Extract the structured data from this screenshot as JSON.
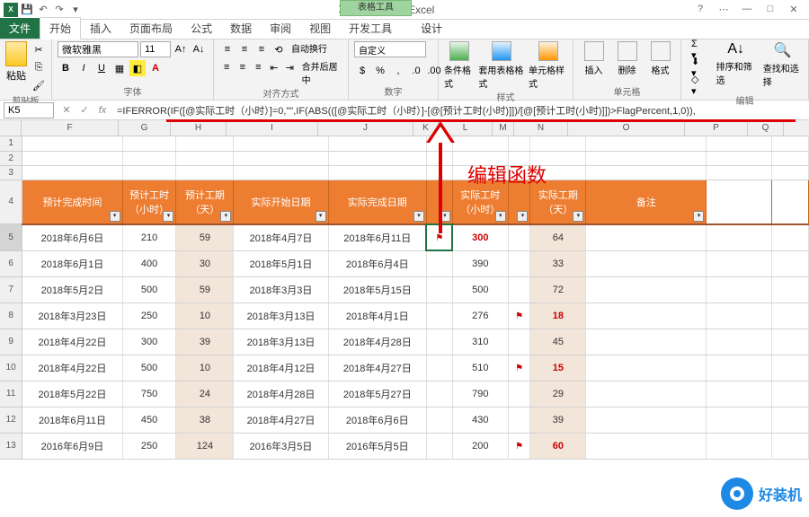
{
  "title": "项目跟踪器1 - Excel",
  "context_tab": "表格工具",
  "tabs": {
    "file": "文件",
    "home": "开始",
    "insert": "插入",
    "layout": "页面布局",
    "formulas": "公式",
    "data": "数据",
    "review": "审阅",
    "view": "视图",
    "developer": "开发工具",
    "design": "设计"
  },
  "ribbon": {
    "clipboard": "剪贴板",
    "paste": "粘贴",
    "font_group": "字体",
    "font_name": "微软雅黑",
    "font_size": "11",
    "align_group": "对齐方式",
    "wrap": "自动换行",
    "merge": "合并后居中",
    "number_group": "数字",
    "number_format": "自定义",
    "styles_group": "样式",
    "cond_format": "条件格式",
    "table_format": "套用表格格式",
    "cell_styles": "单元格样式",
    "cells_group": "单元格",
    "insert_cell": "插入",
    "delete_cell": "删除",
    "format_cell": "格式",
    "edit_group": "编辑",
    "sort_filter": "排序和筛选",
    "find_select": "查找和选择"
  },
  "name_box": "K5",
  "formula": "=IFERROR(IF([@实际工时（小时）]=0,\"\",IF(ABS(([@实际工时（小时）]-[@[预计工时(小时)]])/[@[预计工时(小时)]])>FlagPercent,1,0)),",
  "columns": [
    "F",
    "G",
    "H",
    "I",
    "J",
    "K",
    "L",
    "M",
    "N",
    "O",
    "P",
    "Q"
  ],
  "headers": {
    "f": "预计完成时间",
    "g": "预计工时（小时）",
    "h": "预计工期（天）",
    "i": "实际开始日期",
    "j": "实际完成日期",
    "k": "",
    "l": "实际工时（小时）",
    "n": "实际工期（天）",
    "o": "备注"
  },
  "rows": [
    {
      "n": "5",
      "f": "2018年6月6日",
      "g": "210",
      "h": "59",
      "i": "2018年4月7日",
      "j": "2018年6月11日",
      "kflag": true,
      "l": "300",
      "lred": true,
      "mflag": false,
      "nval": "64",
      "nred": false
    },
    {
      "n": "6",
      "f": "2018年6月1日",
      "g": "400",
      "h": "30",
      "i": "2018年5月1日",
      "j": "2018年6月4日",
      "kflag": false,
      "l": "390",
      "lred": false,
      "mflag": false,
      "nval": "33",
      "nred": false
    },
    {
      "n": "7",
      "f": "2018年5月2日",
      "g": "500",
      "h": "59",
      "i": "2018年3月3日",
      "j": "2018年5月15日",
      "kflag": false,
      "l": "500",
      "lred": false,
      "mflag": false,
      "nval": "72",
      "nred": false
    },
    {
      "n": "8",
      "f": "2018年3月23日",
      "g": "250",
      "h": "10",
      "i": "2018年3月13日",
      "j": "2018年4月1日",
      "kflag": false,
      "l": "276",
      "lred": false,
      "mflag": true,
      "nval": "18",
      "nred": true
    },
    {
      "n": "9",
      "f": "2018年4月22日",
      "g": "300",
      "h": "39",
      "i": "2018年3月13日",
      "j": "2018年4月28日",
      "kflag": false,
      "l": "310",
      "lred": false,
      "mflag": false,
      "nval": "45",
      "nred": false
    },
    {
      "n": "10",
      "f": "2018年4月22日",
      "g": "500",
      "h": "10",
      "i": "2018年4月12日",
      "j": "2018年4月27日",
      "kflag": false,
      "l": "510",
      "lred": false,
      "mflag": true,
      "nval": "15",
      "nred": true
    },
    {
      "n": "11",
      "f": "2018年5月22日",
      "g": "750",
      "h": "24",
      "i": "2018年4月28日",
      "j": "2018年5月27日",
      "kflag": false,
      "l": "790",
      "lred": false,
      "mflag": false,
      "nval": "29",
      "nred": false
    },
    {
      "n": "12",
      "f": "2018年6月11日",
      "g": "450",
      "h": "38",
      "i": "2018年4月27日",
      "j": "2018年6月6日",
      "kflag": false,
      "l": "430",
      "lred": false,
      "mflag": false,
      "nval": "39",
      "nred": false
    },
    {
      "n": "13",
      "f": "2016年6月9日",
      "g": "250",
      "h": "124",
      "i": "2016年3月5日",
      "j": "2016年5月5日",
      "kflag": false,
      "l": "200",
      "lred": false,
      "mflag": true,
      "nval": "60",
      "nred": true
    }
  ],
  "annotation": "编辑函数",
  "watermark": "好装机"
}
